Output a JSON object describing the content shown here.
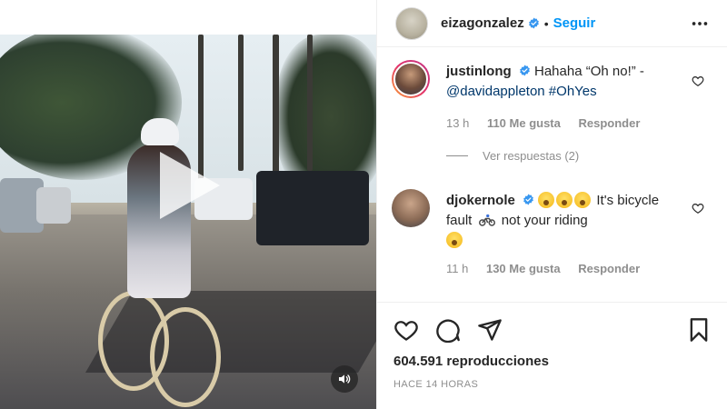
{
  "header": {
    "username": "eizagonzalez",
    "separator": "•",
    "follow_label": "Seguir"
  },
  "comments": [
    {
      "username": "justinlong",
      "text": "Hahaha “Oh no!” -",
      "mention": "@davidappleton #OhYes",
      "time": "13 h",
      "likes": "110 Me gusta",
      "reply_label": "Responder",
      "view_replies": "Ver respuestas (2)"
    },
    {
      "username": "djokernole",
      "text_after_emojis": "It's bicycle fault",
      "text_after_bike": "not your riding",
      "time": "11 h",
      "likes": "130 Me gusta",
      "reply_label": "Responder"
    }
  ],
  "stats": {
    "views": "604.591 reproducciones",
    "time_ago": "HACE 14 HORAS"
  },
  "icons": {
    "verified": "verified-badge-icon",
    "more": "more-options-icon",
    "like": "heart-icon",
    "comment": "comment-bubble-icon",
    "share": "paper-plane-icon",
    "save": "bookmark-icon",
    "play": "play-icon",
    "mute": "speaker-icon"
  },
  "colors": {
    "accent": "#0095f6",
    "verified": "#3897f0",
    "text": "#262626",
    "muted": "#8e8e8e"
  }
}
